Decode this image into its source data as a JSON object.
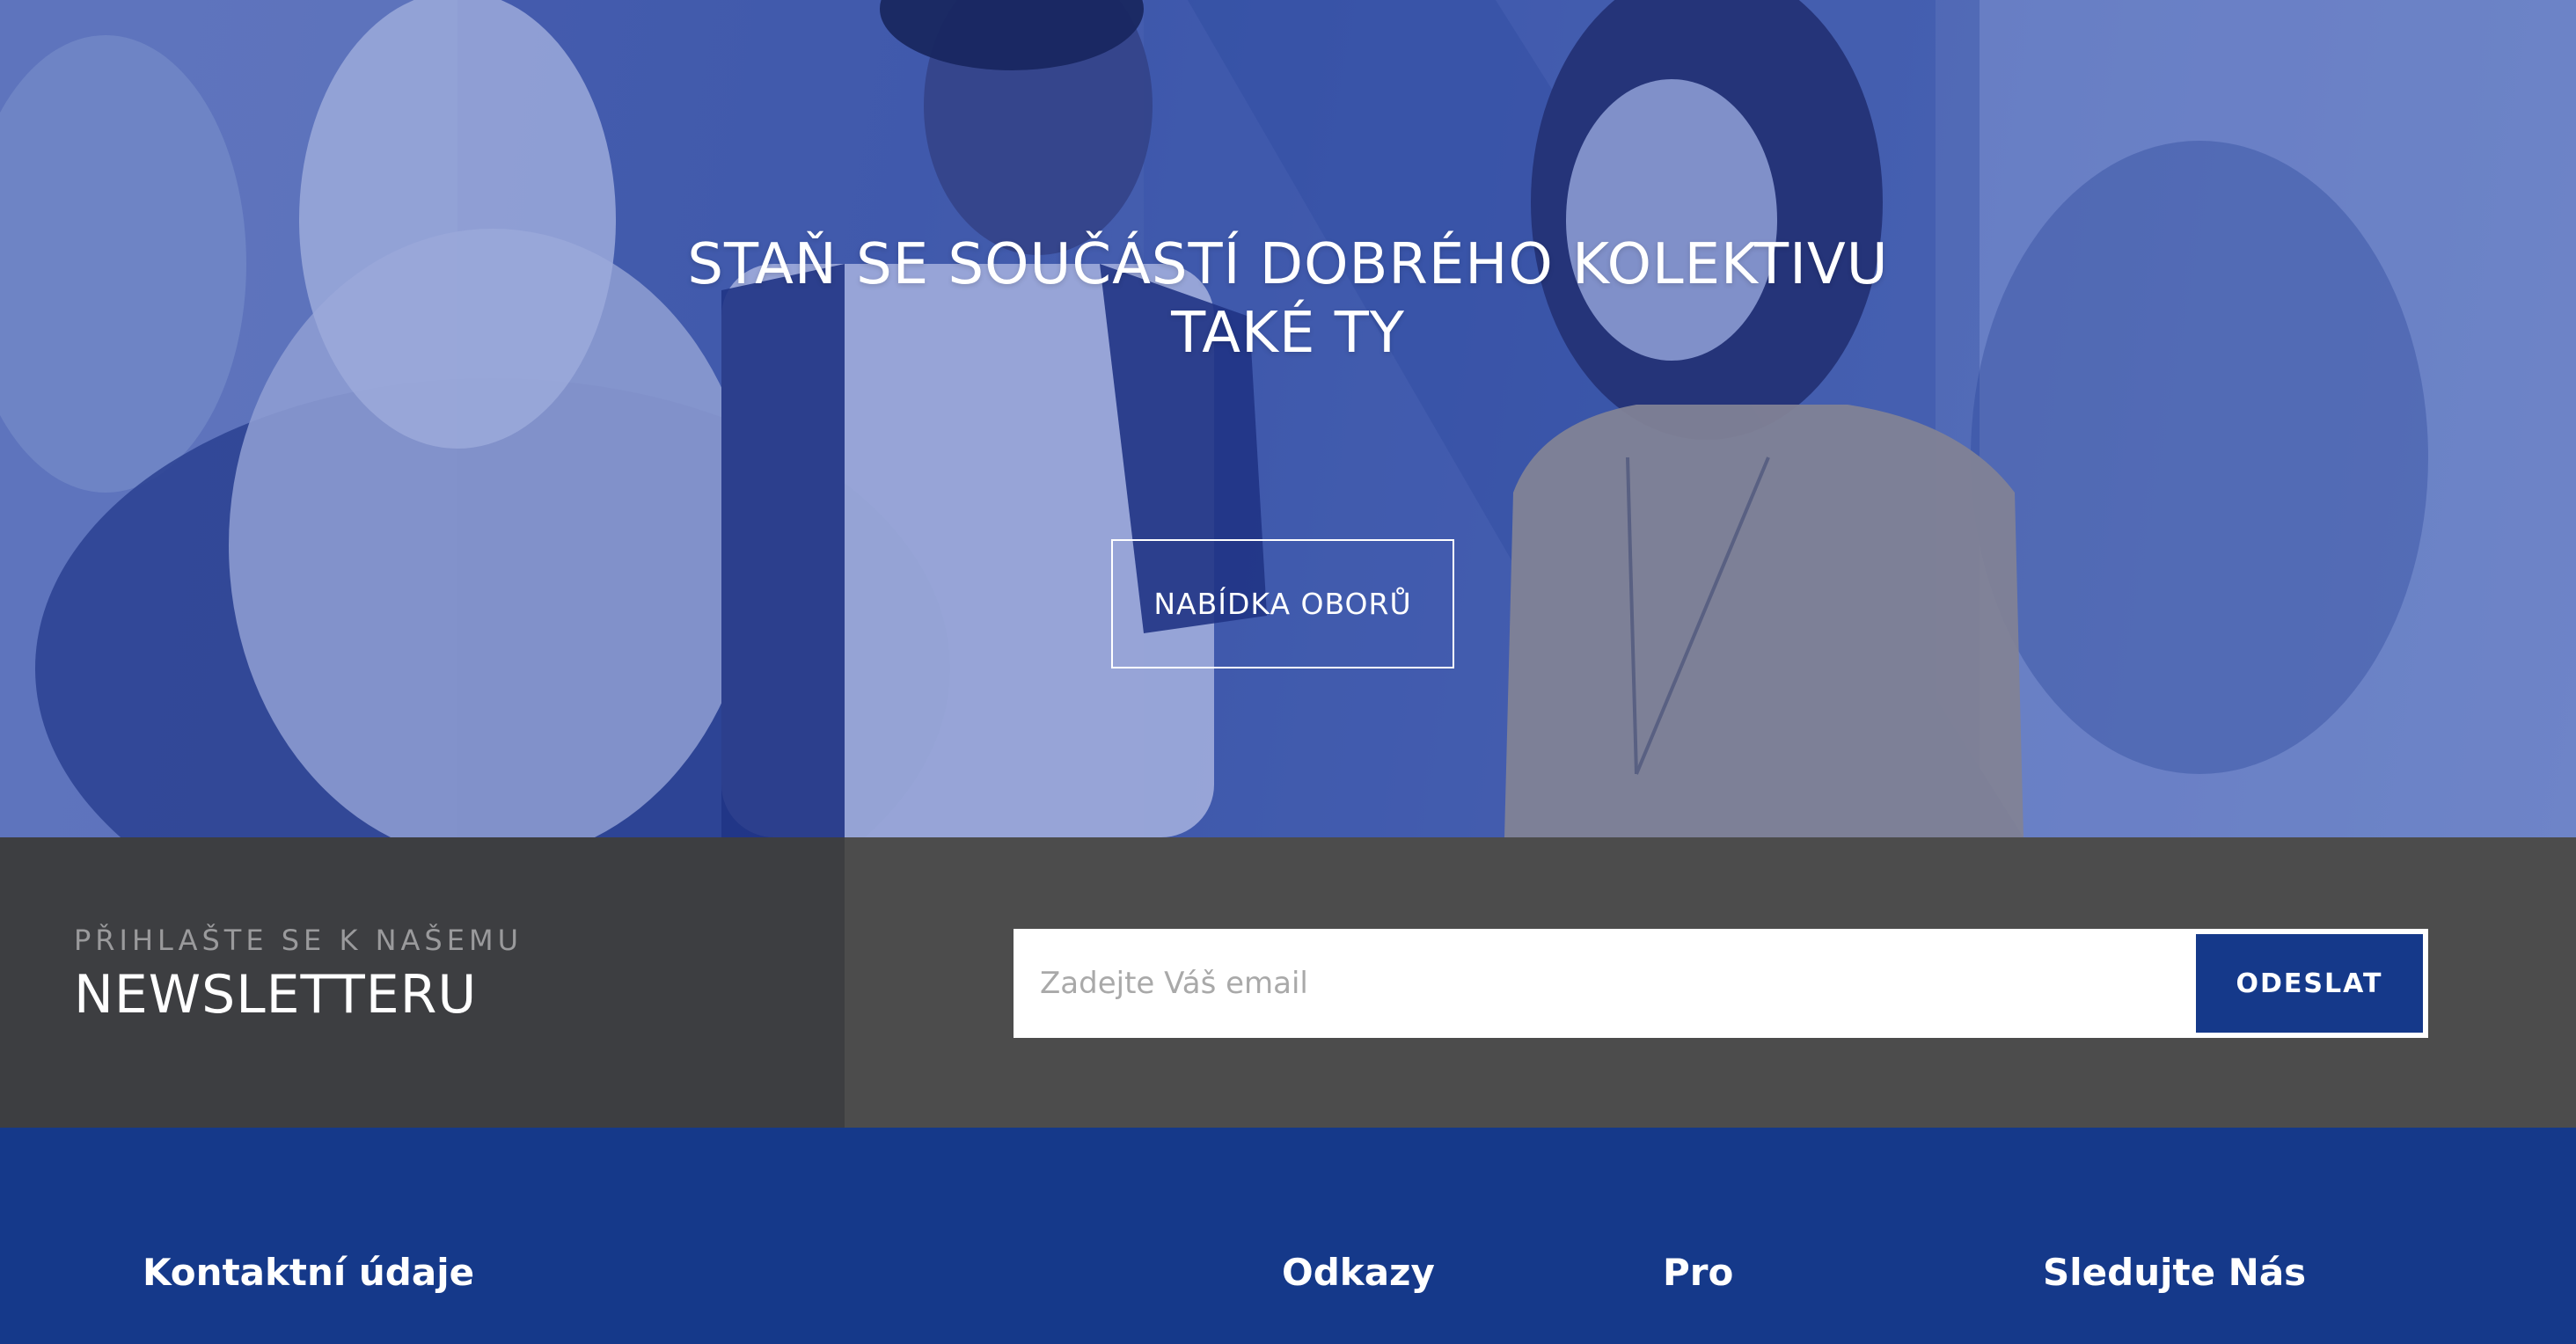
{
  "hero": {
    "title_line1": "STAŇ SE SOUČÁSTÍ DOBRÉHO KOLEKTIVU",
    "title_line2": "TAKÉ TY",
    "cta_label": "NABÍDKA OBORŮ"
  },
  "newsletter": {
    "kicker": "PŘIHLAŠTE SE K NAŠEMU",
    "heading": "NEWSLETTERU",
    "email_placeholder": "Zadejte Váš email",
    "submit_label": "ODESLAT"
  },
  "footer": {
    "columns": [
      {
        "title": "Kontaktní údaje"
      },
      {
        "title": "Odkazy"
      },
      {
        "title": "Pro"
      },
      {
        "title": "Sledujte Nás"
      }
    ]
  },
  "colors": {
    "brand_blue": "#15398a",
    "newsletter_left": "#3d3e41",
    "newsletter_right": "#4c4c4c"
  }
}
